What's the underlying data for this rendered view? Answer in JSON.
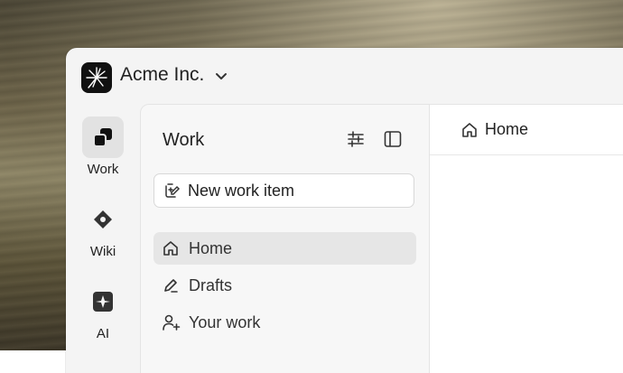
{
  "workspace": {
    "name": "Acme Inc."
  },
  "rail": {
    "items": [
      {
        "label": "Work",
        "icon": "work-icon",
        "active": true
      },
      {
        "label": "Wiki",
        "icon": "wiki-icon",
        "active": false
      },
      {
        "label": "AI",
        "icon": "ai-icon",
        "active": false
      }
    ]
  },
  "sidepanel": {
    "title": "Work",
    "new_button_label": "New work item",
    "nav": [
      {
        "label": "Home",
        "icon": "home-icon",
        "active": true
      },
      {
        "label": "Drafts",
        "icon": "pen-icon",
        "active": false
      },
      {
        "label": "Your work",
        "icon": "user-plus-icon",
        "active": false
      }
    ]
  },
  "main": {
    "breadcrumb": "Home"
  },
  "colors": {
    "active_bg": "#e6e6e6",
    "logo_bg": "#111111"
  }
}
